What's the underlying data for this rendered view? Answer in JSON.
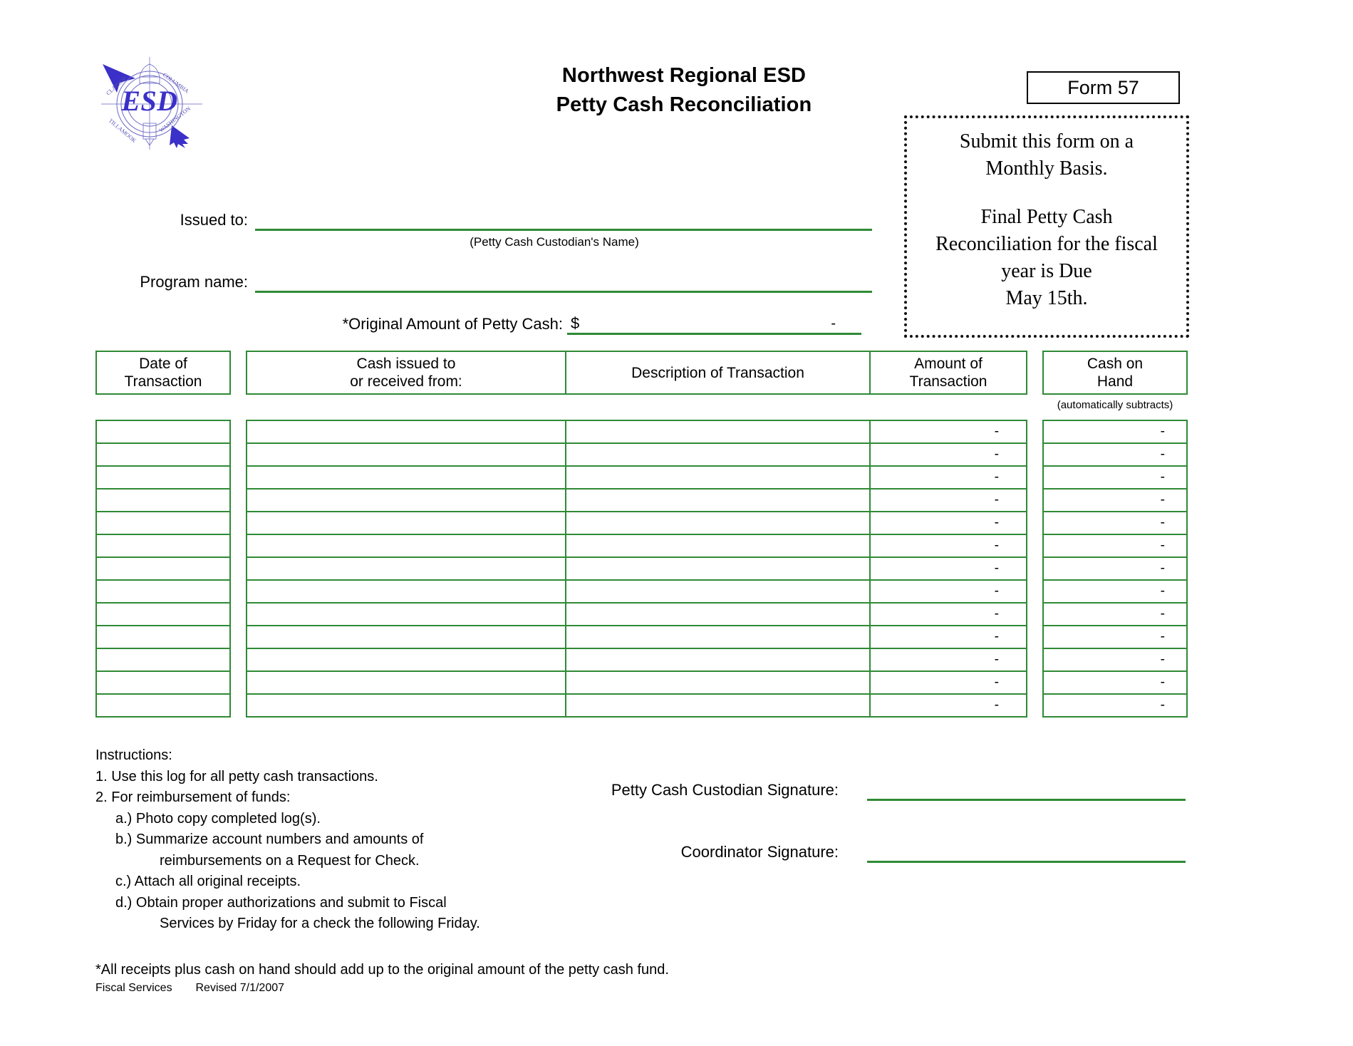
{
  "document": {
    "org_title": "Northwest Regional ESD",
    "form_title": "Petty Cash Reconciliation",
    "form_number": "Form 57",
    "logo_name": "esd-compass-seal-logo"
  },
  "notice": {
    "line1": "Submit this form on a",
    "line2": "Monthly Basis.",
    "line3": "Final Petty Cash",
    "line4": "Reconciliation for the fiscal",
    "line5": "year is Due",
    "line6": "May 15th."
  },
  "fields": {
    "issued_to_label": "Issued to:",
    "issued_to_value": "",
    "issued_to_sub": "(Petty Cash Custodian's Name)",
    "program_name_label": "Program name:",
    "program_name_value": "",
    "original_amount_label": "*Original Amount of Petty Cash:",
    "original_amount_currency": "$",
    "original_amount_value": "-"
  },
  "table": {
    "headers": [
      {
        "line1": "Date of",
        "line2": "Transaction"
      },
      {
        "line1": "Cash issued to",
        "line2": "or received from:"
      },
      {
        "line1": "Description of Transaction",
        "line2": ""
      },
      {
        "line1": "Amount of",
        "line2": "Transaction"
      },
      {
        "line1": "Cash on",
        "line2": "Hand"
      }
    ],
    "cash_on_hand_note": "(automatically subtracts)",
    "row_count": 13,
    "rows": [
      {
        "date": "",
        "issued_to": "",
        "description": "",
        "amount": "-",
        "cash_on_hand": "-"
      },
      {
        "date": "",
        "issued_to": "",
        "description": "",
        "amount": "-",
        "cash_on_hand": "-"
      },
      {
        "date": "",
        "issued_to": "",
        "description": "",
        "amount": "-",
        "cash_on_hand": "-"
      },
      {
        "date": "",
        "issued_to": "",
        "description": "",
        "amount": "-",
        "cash_on_hand": "-"
      },
      {
        "date": "",
        "issued_to": "",
        "description": "",
        "amount": "-",
        "cash_on_hand": "-"
      },
      {
        "date": "",
        "issued_to": "",
        "description": "",
        "amount": "-",
        "cash_on_hand": "-"
      },
      {
        "date": "",
        "issued_to": "",
        "description": "",
        "amount": "-",
        "cash_on_hand": "-"
      },
      {
        "date": "",
        "issued_to": "",
        "description": "",
        "amount": "-",
        "cash_on_hand": "-"
      },
      {
        "date": "",
        "issued_to": "",
        "description": "",
        "amount": "-",
        "cash_on_hand": "-"
      },
      {
        "date": "",
        "issued_to": "",
        "description": "",
        "amount": "-",
        "cash_on_hand": "-"
      },
      {
        "date": "",
        "issued_to": "",
        "description": "",
        "amount": "-",
        "cash_on_hand": "-"
      },
      {
        "date": "",
        "issued_to": "",
        "description": "",
        "amount": "-",
        "cash_on_hand": "-"
      },
      {
        "date": "",
        "issued_to": "",
        "description": "",
        "amount": "-",
        "cash_on_hand": "-"
      }
    ]
  },
  "instructions": {
    "heading": "Instructions:",
    "items": [
      "1.  Use this log for all petty cash transactions.",
      "2.  For reimbursement of funds:",
      "a.)  Photo copy completed log(s).",
      "b.)  Summarize account numbers and amounts of",
      "reimbursements on a Request for Check.",
      "c.)  Attach all original receipts.",
      "d.)  Obtain proper authorizations and submit to Fiscal",
      "Services by Friday for a check the following Friday."
    ]
  },
  "signatures": {
    "custodian_label": "Petty Cash Custodian Signature:",
    "custodian_value": "",
    "coordinator_label": "Coordinator Signature:",
    "coordinator_value": ""
  },
  "footer": {
    "footnote": "*All receipts plus cash on hand should add up to the original amount of the petty cash fund.",
    "department": "Fiscal Services",
    "revision": "Revised 7/1/2007"
  },
  "colors": {
    "line_green": "#2f8a35",
    "logo_blue": "#3b30c8",
    "text_black": "#000000"
  }
}
